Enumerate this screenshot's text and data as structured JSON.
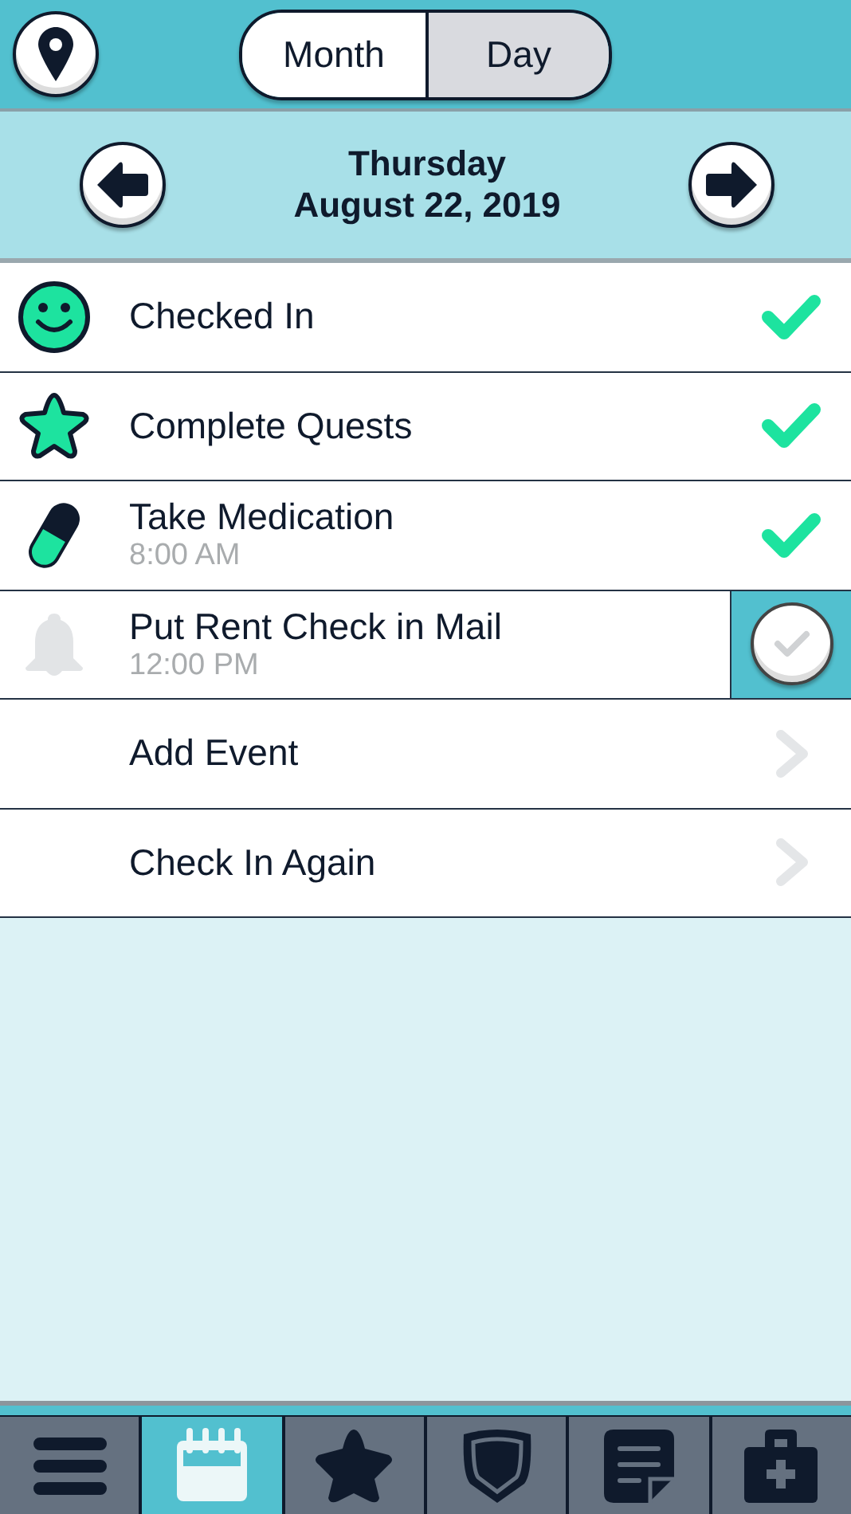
{
  "view_toggle": [
    {
      "label": "Month",
      "selected": false
    },
    {
      "label": "Day",
      "selected": true
    }
  ],
  "date": {
    "weekday": "Thursday",
    "date": "August 22, 2019"
  },
  "events": [
    {
      "kind": "task",
      "title": "Checked In",
      "done": true
    },
    {
      "kind": "task",
      "title": "Complete Quests",
      "done": true
    },
    {
      "kind": "task",
      "title": "Take Medication",
      "time": "8:00 AM",
      "done": true
    },
    {
      "kind": "task",
      "title": "Put Rent Check in Mail",
      "time": "12:00 PM",
      "done": false
    },
    {
      "kind": "action",
      "title": "Add Event"
    },
    {
      "kind": "action",
      "title": "Check In Again"
    }
  ],
  "tab_bar": [
    {
      "selected": false
    },
    {
      "selected": true
    },
    {
      "selected": false
    },
    {
      "selected": false
    },
    {
      "selected": false
    },
    {
      "selected": false
    }
  ]
}
